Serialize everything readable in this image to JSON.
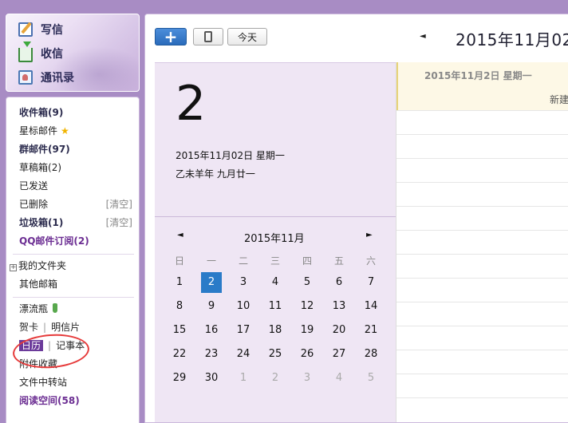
{
  "sidebar": {
    "top_actions": [
      {
        "label": "写信",
        "icon": "compose-icon"
      },
      {
        "label": "收信",
        "icon": "inbox-download-icon"
      },
      {
        "label": "通讯录",
        "icon": "contacts-icon"
      }
    ],
    "folders": {
      "inbox": {
        "label": "收件箱",
        "count": "(9)"
      },
      "starred": {
        "label": "星标邮件"
      },
      "group": {
        "label": "群邮件",
        "count": "(97)"
      },
      "drafts": {
        "label": "草稿箱",
        "count": "(2)"
      },
      "sent": {
        "label": "已发送"
      },
      "deleted": {
        "label": "已删除",
        "clear": "[清空]"
      },
      "spam": {
        "label": "垃圾箱",
        "count": "(1)",
        "clear": "[清空]"
      },
      "qq_subscribe": {
        "label": "QQ邮件订阅",
        "count": "(2)"
      },
      "my_folders": {
        "label": "我的文件夹",
        "expand": "+"
      },
      "other_mailbox": {
        "label": "其他邮箱"
      },
      "drift_bottle": {
        "label": "漂流瓶"
      },
      "greeting_card": {
        "label": "贺卡"
      },
      "postcard": {
        "label": "明信片"
      },
      "calendar": {
        "label": "日历"
      },
      "notebook": {
        "label": "记事本"
      },
      "attachments": {
        "label": "附件收藏"
      },
      "file_transfer": {
        "label": "文件中转站"
      },
      "reading_space": {
        "label": "阅读空间",
        "count": "(58)"
      }
    }
  },
  "toolbar": {
    "add_label": "+",
    "today_label": "今天",
    "prev_arrow": "◄",
    "date_title": "2015年11月02"
  },
  "day_panel": {
    "big_day": "2",
    "full_date": "2015年11月02日 星期一",
    "lunar_date": "乙未羊年 九月廿一"
  },
  "mini_calendar": {
    "prev_arrow": "◄",
    "next_arrow": "►",
    "title": "2015年11月",
    "weekdays": [
      "日",
      "一",
      "二",
      "三",
      "四",
      "五",
      "六"
    ],
    "weeks": [
      [
        "1",
        "2",
        "3",
        "4",
        "5",
        "6",
        "7"
      ],
      [
        "8",
        "9",
        "10",
        "11",
        "12",
        "13",
        "14"
      ],
      [
        "15",
        "16",
        "17",
        "18",
        "19",
        "20",
        "21"
      ],
      [
        "22",
        "23",
        "24",
        "25",
        "26",
        "27",
        "28"
      ],
      [
        "29",
        "30",
        "1",
        "2",
        "3",
        "4",
        "5"
      ]
    ],
    "selected_day": "2",
    "colors": {
      "selected": "#2a7bc8",
      "panel_bg": "#efe6f4"
    }
  },
  "schedule": {
    "date_header": "2015年11月2日 星期一",
    "new_label": "新建"
  }
}
